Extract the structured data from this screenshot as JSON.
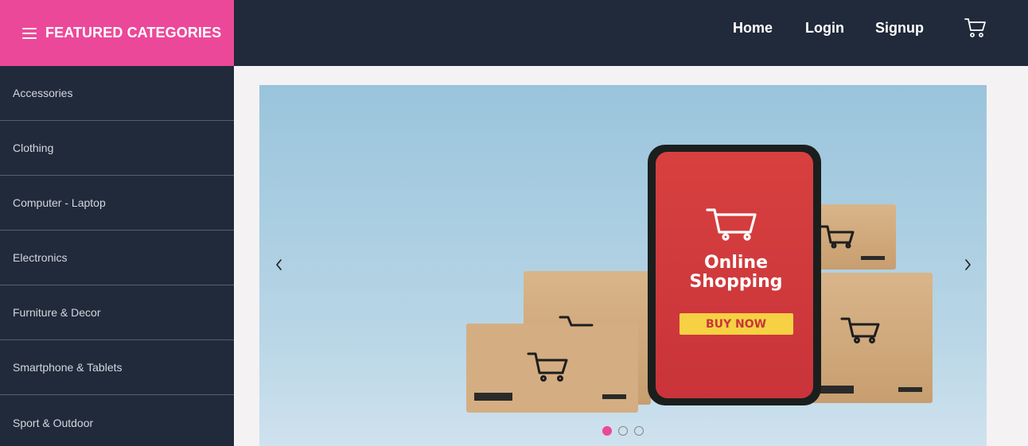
{
  "header": {
    "brand_label": "FEATURED CATEGORIES",
    "nav": {
      "home": "Home",
      "login": "Login",
      "signup": "Signup"
    }
  },
  "sidebar": {
    "items": [
      {
        "label": "Accessories"
      },
      {
        "label": "Clothing"
      },
      {
        "label": "Computer - Laptop"
      },
      {
        "label": "Electronics"
      },
      {
        "label": "Furniture & Decor"
      },
      {
        "label": "Smartphone & Tablets"
      },
      {
        "label": "Sport & Outdoor"
      }
    ]
  },
  "carousel": {
    "slide_title_line1": "Online",
    "slide_title_line2": "Shopping",
    "slide_button": "BUY NOW",
    "slide_count": 3,
    "active_slide": 1
  },
  "colors": {
    "accent": "#ec4899",
    "header_bg": "#212a3b",
    "phone_red": "#d13a3e",
    "buy_now_yellow": "#f5d143"
  },
  "icons": {
    "menu": "hamburger-icon",
    "cart": "cart-icon",
    "prev": "chevron-left-icon",
    "next": "chevron-right-icon"
  }
}
